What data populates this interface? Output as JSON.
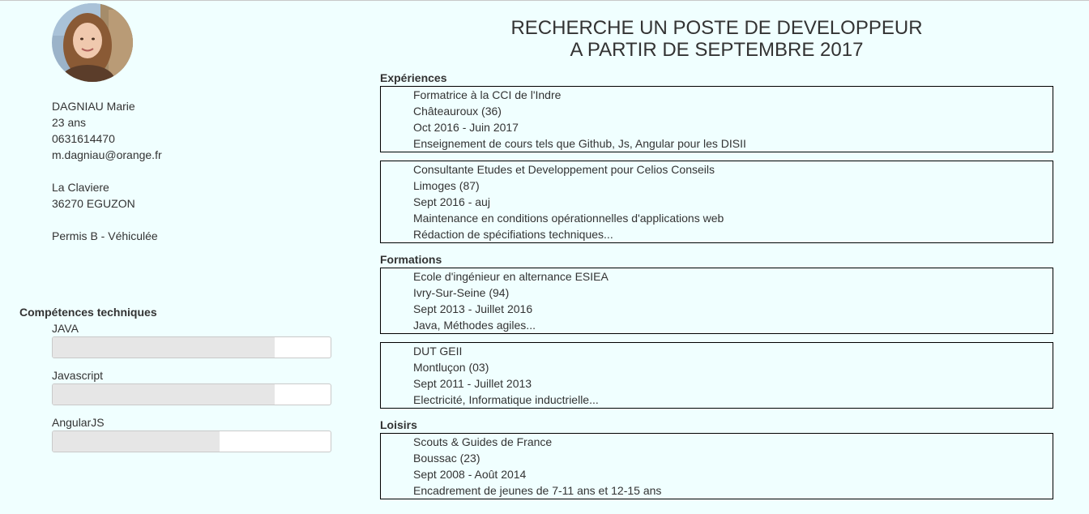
{
  "profile": {
    "name": "DAGNIAU Marie",
    "age": "23 ans",
    "phone": "0631614470",
    "email": "m.dagniau@orange.fr",
    "address_line1": "La Claviere",
    "address_line2": "36270 EGUZON",
    "license": "Permis B - Véhiculée"
  },
  "headline": {
    "line1": "RECHERCHE UN POSTE DE DEVELOPPEUR",
    "line2": "A PARTIR DE SEPTEMBRE 2017"
  },
  "skills": {
    "title": "Compétences techniques",
    "items": [
      {
        "label": "JAVA",
        "level": 0.8
      },
      {
        "label": "Javascript",
        "level": 0.8
      },
      {
        "label": "AngularJS",
        "level": 0.6
      }
    ]
  },
  "experiences": {
    "title": "Expériences",
    "items": [
      {
        "role": "Formatrice à la CCI de l'Indre",
        "place": "Châteauroux (36)",
        "dates": "Oct 2016 - Juin 2017",
        "details": [
          "Enseignement de cours tels que Github, Js, Angular pour les DISII"
        ]
      },
      {
        "role": "Consultante Etudes et Developpement pour Celios Conseils",
        "place": "Limoges (87)",
        "dates": "Sept 2016 - auj",
        "details": [
          "Maintenance en conditions opérationnelles d'applications web",
          "Rédaction de spécifiations techniques..."
        ]
      }
    ]
  },
  "formations": {
    "title": "Formations",
    "items": [
      {
        "role": "Ecole d'ingénieur en alternance ESIEA",
        "place": "Ivry-Sur-Seine (94)",
        "dates": "Sept 2013 - Juillet 2016",
        "details": [
          "Java, Méthodes agiles..."
        ]
      },
      {
        "role": "DUT GEII",
        "place": "Montluçon (03)",
        "dates": "Sept 2011 - Juillet 2013",
        "details": [
          "Electricité, Informatique inductrielle..."
        ]
      }
    ]
  },
  "loisirs": {
    "title": "Loisirs",
    "items": [
      {
        "role": "Scouts & Guides de France",
        "place": "Boussac (23)",
        "dates": "Sept 2008 - Août 2014",
        "details": [
          "Encadrement de jeunes de 7-11 ans et 12-15 ans"
        ]
      }
    ]
  }
}
